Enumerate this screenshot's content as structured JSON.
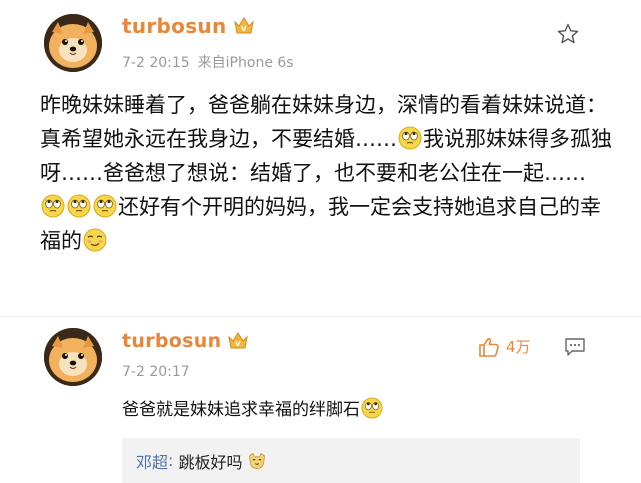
{
  "post": {
    "username": "turbosun",
    "time": "7-2 20:15",
    "source": "来自iPhone 6s",
    "text_1": "昨晚妹妹睡着了，爸爸躺在妹妹身边，深情的看着妹妹说道：真希望她永远在我身边，不要结婚……",
    "text_2": "我说那妹妹得多孤独呀……爸爸想了想说：结婚了，也不要和老公住在一起……",
    "text_3": "还好有个开明的妈妈，我一定会支持她追求自己的幸福的",
    "icons": [
      "avatar-dog",
      "vip-badge-icon",
      "star-icon",
      "eye-roll-emoji",
      "smirk-emoji"
    ]
  },
  "comment": {
    "username": "turbosun",
    "time": "7-2 20:17",
    "like_count": "4万",
    "text": "爸爸就是妹妹追求幸福的绊脚石",
    "icons": [
      "thumbs-up-icon",
      "reply-icon",
      "eye-roll-emoji"
    ]
  },
  "sub_reply": {
    "name": "邓超",
    "colon": ":",
    "text": " 跳板好吗",
    "icons": [
      "cat-emoji"
    ]
  },
  "colors": {
    "username": "#e8873a",
    "link": "#4d75a9",
    "meta": "#9a9a9a",
    "reply_bg": "#f2f2f2"
  }
}
